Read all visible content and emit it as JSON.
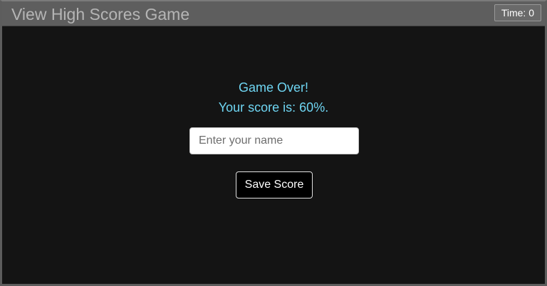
{
  "header": {
    "title": "View High Scores Game",
    "timer_label": "Time: 0"
  },
  "game_over": {
    "heading": "Game Over!",
    "score_text": "Your score is: 60%."
  },
  "form": {
    "name_placeholder": "Enter your name",
    "name_value": "",
    "save_label": "Save Score"
  },
  "colors": {
    "accent": "#6fd6f3",
    "background": "#141414",
    "header_bg": "#5e5e5e"
  }
}
